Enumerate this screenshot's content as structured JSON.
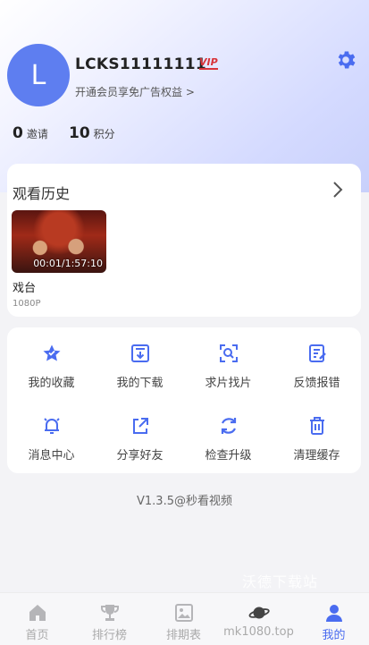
{
  "profile": {
    "avatar_letter": "L",
    "username": "LCKS11111111",
    "vip_badge": "VIP",
    "vip_promo": "开通会员享免广告权益 >"
  },
  "stats": {
    "invites_count": "0",
    "invites_label": "邀请",
    "points_count": "10",
    "points_label": "积分"
  },
  "history": {
    "title": "观看历史",
    "items": [
      {
        "time": "00:01/1:57:10",
        "name": "戏台",
        "resolution": "1080P"
      }
    ]
  },
  "tools": [
    {
      "label": "我的收藏",
      "icon": "star-icon"
    },
    {
      "label": "我的下载",
      "icon": "download-icon"
    },
    {
      "label": "求片找片",
      "icon": "scan-search-icon"
    },
    {
      "label": "反馈报错",
      "icon": "feedback-icon"
    },
    {
      "label": "消息中心",
      "icon": "bell-icon"
    },
    {
      "label": "分享好友",
      "icon": "share-icon"
    },
    {
      "label": "检查升级",
      "icon": "refresh-icon"
    },
    {
      "label": "清理缓存",
      "icon": "trash-icon"
    }
  ],
  "version": "V1.3.5@秒看视频",
  "watermark": "沃德下载站",
  "tabbar": [
    {
      "label": "首页",
      "icon": "home-icon"
    },
    {
      "label": "排行榜",
      "icon": "trophy-icon"
    },
    {
      "label": "排期表",
      "icon": "schedule-icon"
    },
    {
      "label": "mk1080.top",
      "icon": "planet-icon"
    },
    {
      "label": "我的",
      "icon": "user-icon",
      "active": true
    }
  ],
  "colors": {
    "accent": "#4a6cf0",
    "avatar": "#5e7ef0",
    "vip": "#d8343a"
  }
}
